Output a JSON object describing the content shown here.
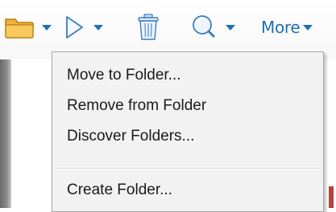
{
  "toolbar": {
    "buttons": [
      {
        "name": "folder",
        "icon": "folder-icon",
        "has_dropdown": true
      },
      {
        "name": "play",
        "icon": "play-icon",
        "has_dropdown": true
      },
      {
        "name": "delete",
        "icon": "trash-icon",
        "has_dropdown": false
      },
      {
        "name": "search",
        "icon": "search-icon",
        "has_dropdown": true
      }
    ],
    "more_label": "More"
  },
  "menu": {
    "items": [
      {
        "label": "Move to Folder..."
      },
      {
        "label": "Remove from Folder"
      },
      {
        "label": "Discover Folders..."
      },
      {
        "label": "Create Folder..."
      }
    ]
  },
  "colors": {
    "accent": "#1f6fba",
    "folder": "#f0b23a",
    "menu_background": "#f2f2f2",
    "menu_border": "#a7a7a7"
  }
}
